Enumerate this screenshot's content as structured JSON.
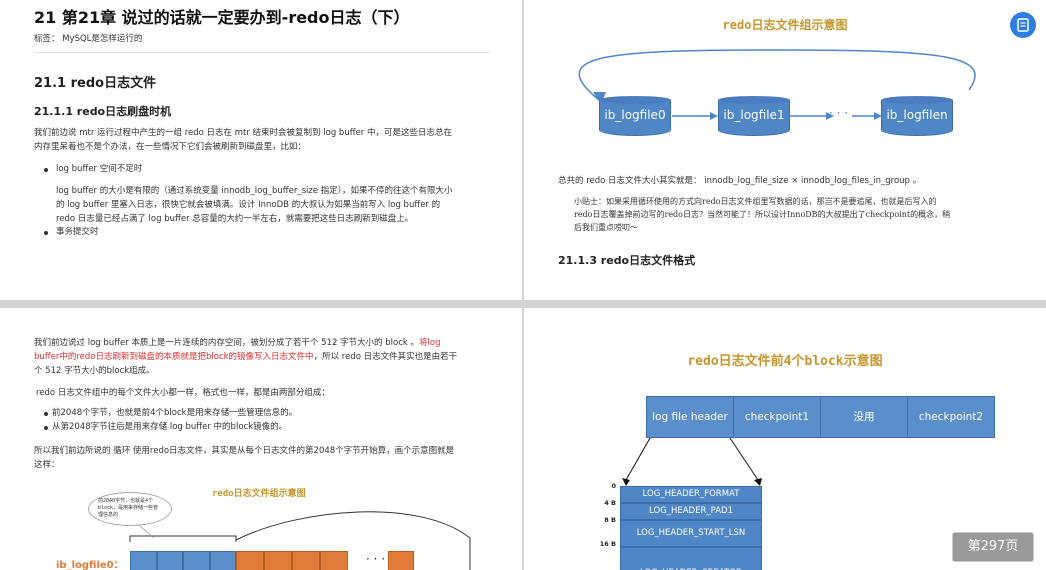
{
  "page1": {
    "chapter_title": "21 第21章 说过的话就一定要办到-redo日志（下）",
    "tag": "标签： MySQL是怎样运行的",
    "section": "21.1 redo日志文件",
    "subsection": "21.1.1 redo日志刷盘时机",
    "intro_line1": "我们前边说 mtr 运行过程中产生的一组 redo 日志在 mtr 结束时会被复制到 log buffer 中，可是这些日志总在",
    "intro_line2": "内存里呆着也不是个办法，在一些情况下它们会被刷新到磁盘里，比如：",
    "bullet1": "log buffer 空间不足时",
    "detail_line1": "log buffer 的大小是有限的（通过系统变量 innodb_log_buffer_size 指定），如果不停的往这个有限大小",
    "detail_line2": "的 log buffer 里塞入日志，很快它就会被填满。设计 InnoDB 的大叔认为如果当前写入 log buffer 的",
    "detail_line3": "redo 日志量已经占满了 log buffer 总容量的大约一半左右，就需要把这些日志刷新到磁盘上。",
    "bullet2": "事务提交时"
  },
  "page2": {
    "diagram_title": "redo日志文件组示意图",
    "files": [
      "ib_logfile0",
      "ib_logfile1",
      "ib_logfilen"
    ],
    "ellipsis": "· · ·",
    "formula": "总共的 redo 日志文件大小其实就是： innodb_log_file_size × innodb_log_files_in_group 。",
    "tip_line1": "小贴士：如果采用循环使用的方式向redo日志文件组里写数据的话，那岂不是要追尾，也就是后写入的",
    "tip_line2": "redo日志覆盖掉前边写的redo日志？当然可能了！所以设计InnoDB的大叔提出了checkpoint的概念，稍",
    "tip_line3": "后我们重点唠叨～",
    "subsection": "21.1.3 redo日志文件格式"
  },
  "page3": {
    "para1_line1_a": "我们前边说过 log buffer 本质上是一片连续的内存空间，被划分成了若干个 512 字节大小的 block 。",
    "para1_line1_red": "将log",
    "para1_line2_red": "buffer中的redo日志刷新到磁盘的本质就是把block的镜像写入日志文件中",
    "para1_line2_b": "，所以 redo 日志文件其实也是由若干",
    "para1_line3": "个 512 字节大小的block组成。",
    "para2": "redo 日志文件组中的每个文件大小都一样，格式也一样，都是由两部分组成：",
    "bullet1": "前2048个字节，也就是前4个block是用来存储一些管理信息的。",
    "bullet2": "从第2048字节往后是用来存储 log buffer 中的block镜像的。",
    "para3_line1": "所以我们前边所说的 循环 使用redo日志文件，其实是从每个日志文件的第2048个字节开始算，画个示意图就是",
    "para3_line2": "这样：",
    "bubble": "前2048字节，也就是4个block，是用来存储一些管理信息的",
    "diagram_title": "redo日志文件组示意图",
    "file_label": "ib_logfile0：",
    "ellipsis": "· · ·"
  },
  "page4": {
    "diagram_title": "redo日志文件前4个block示意图",
    "blocks": [
      "log file header",
      "checkpoint1",
      "没用",
      "checkpoint2"
    ],
    "offsets": [
      "0",
      "4 B",
      "8 B",
      "16 B"
    ],
    "header_fields": [
      "LOG_HEADER_FORMAT",
      "LOG_HEADER_PAD1",
      "LOG_HEADER_START_LSN",
      "LOG_HEADER_CREATOR"
    ]
  },
  "pager": {
    "label": "第297页"
  },
  "colors": {
    "diagram_title": "#c6962c",
    "block_blue": "#5b8fcc",
    "block_orange": "#e07b39",
    "badge": "#2f7de1"
  }
}
